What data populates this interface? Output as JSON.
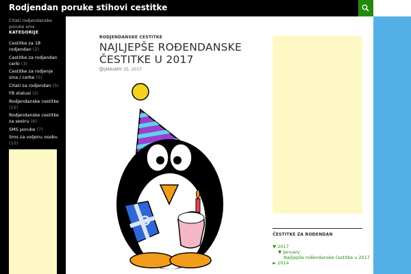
{
  "header": {
    "site_title": "Rodjendan poruke stihovi cestitke"
  },
  "sidebar": {
    "tagline": "Citati rodjendanske poruke sms",
    "categories_title": "KATEGORIJE",
    "categories": [
      {
        "name": "Cestitke za 18 rodjendan",
        "count": "(2)"
      },
      {
        "name": "Cestitke za rodjendan cerki",
        "count": "(3)"
      },
      {
        "name": "Cestitke za rodjenje sina / cerke",
        "count": "(5)"
      },
      {
        "name": "Citati za rodjendan",
        "count": "(5)"
      },
      {
        "name": "FB statusi",
        "count": "(2)"
      },
      {
        "name": "Rodjendanske cestitke",
        "count": "(15)"
      },
      {
        "name": "Rodjendanske cestitke za sestru",
        "count": "(6)"
      },
      {
        "name": "SMS poruke",
        "count": "(7)"
      },
      {
        "name": "Sms za voljenu osobu",
        "count": "(10)"
      }
    ]
  },
  "post": {
    "category": "RODJENDANSKE CESTITKE",
    "title": "NAJLJEPŠE ROĐENDANSKE ČESTITKE U 2017",
    "date": "JANUARY 25, 2017"
  },
  "archive": {
    "title": "ČESTITKE ZA ROĐENDAN",
    "year_2017": "▼ 2017",
    "month_january": "▼ January",
    "post_link": "Najljepše rođendanske čestitke u 2017",
    "year_2014": "► 2014"
  },
  "colors": {
    "accent": "#24890d",
    "header_bg": "#000000",
    "ad_placeholder": "#fef8c4",
    "right_strip": "#56b0e8"
  },
  "icons": {
    "search": "search-icon",
    "date": "clock-icon",
    "image": "birthday-penguin-illustration"
  }
}
